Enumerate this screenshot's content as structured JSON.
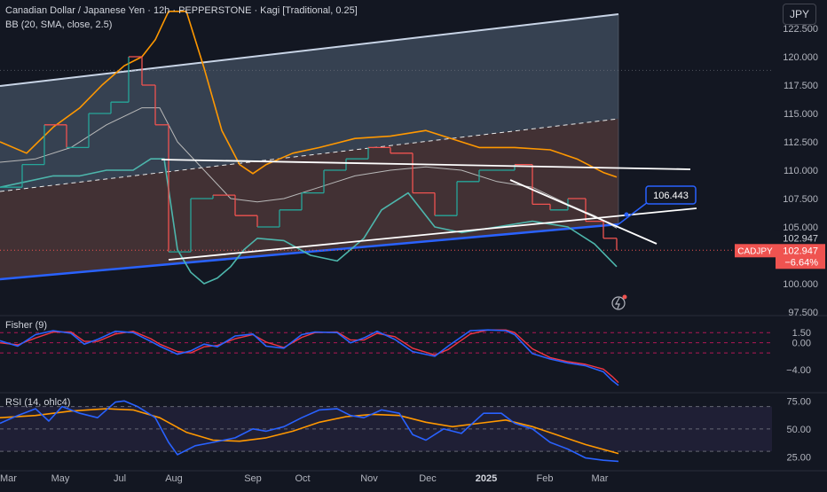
{
  "header": {
    "symbol_line": "Canadian Dollar / Japanese Yen · 12h · PEPPERSTONE · Kagi [Traditional, 0.25]",
    "indicator_line": "BB (20, SMA, close, 2.5)",
    "currency_button": "JPY"
  },
  "price_labels": {
    "last_price": "102.947",
    "symbol_tag": "CADJPY",
    "tag_price": "102.947",
    "tag_change": "−6.64%",
    "target_label": "106.443"
  },
  "colors": {
    "background": "#131722",
    "kagi_up": "#26a69a",
    "kagi_down": "#ef5350",
    "bb_upper": "#ff9800",
    "bb_basis": "#b8b8b8",
    "bb_lower": "#4db6ac",
    "channel_line": "#2962ff",
    "fisher": "#2962ff",
    "fisher_trigger": "#f23645",
    "rsi": "#2962ff",
    "rsi_ma": "#ff9800"
  },
  "chart_data": [
    {
      "type": "line",
      "title": "Canadian Dollar / Japanese Yen · 12h · PEPPERSTONE · Kagi [Traditional, 0.25]",
      "ylim": [
        97.5,
        125.0
      ],
      "y_ticks": [
        "97.500",
        "100.000",
        "102.500",
        "105.000",
        "107.500",
        "110.000",
        "112.500",
        "115.000",
        "117.500",
        "120.000",
        "122.500"
      ],
      "x_ticks": [
        "Mar",
        "May",
        "Jul",
        "Aug",
        "Sep",
        "Oct",
        "Nov",
        "Dec",
        "2025",
        "Feb",
        "Mar"
      ],
      "series": [
        {
          "role": "price-kagi",
          "x": [
            0,
            25,
            50,
            75,
            100,
            125,
            145,
            160,
            175,
            190,
            215,
            240,
            265,
            290,
            315,
            340,
            365,
            390,
            415,
            440,
            465,
            490,
            515,
            540,
            565,
            580,
            600,
            620,
            640,
            660,
            680,
            695
          ],
          "values": [
            108.5,
            110.5,
            114.0,
            112.0,
            115.0,
            116.0,
            120.0,
            117.5,
            114.0,
            102.8,
            107.5,
            107.8,
            106.0,
            105.0,
            106.5,
            108.0,
            110.0,
            111.0,
            112.0,
            111.5,
            108.0,
            106.0,
            109.0,
            110.0,
            110.0,
            110.5,
            107.0,
            106.5,
            107.5,
            105.5,
            104.0,
            102.947
          ]
        },
        {
          "name": "BB",
          "role": "bb-upper",
          "x": [
            0,
            30,
            60,
            90,
            115,
            140,
            160,
            175,
            190,
            210,
            230,
            250,
            270,
            285,
            300,
            330,
            360,
            400,
            440,
            480,
            500,
            540,
            580,
            620,
            650,
            680,
            695
          ],
          "values": [
            112.5,
            111.5,
            113.8,
            115.5,
            117.5,
            119.2,
            120.0,
            121.5,
            124.0,
            124.0,
            119.0,
            113.5,
            110.5,
            109.7,
            110.5,
            111.5,
            112.0,
            112.8,
            113.0,
            113.5,
            113.0,
            112.0,
            112.0,
            111.8,
            111.0,
            109.8,
            109.4
          ]
        },
        {
          "name": "BB",
          "role": "bb-basis",
          "x": [
            0,
            40,
            80,
            120,
            160,
            180,
            200,
            230,
            260,
            290,
            320,
            360,
            400,
            440,
            480,
            520,
            560,
            600,
            640,
            670,
            695
          ],
          "values": [
            110.7,
            111.0,
            112.0,
            114.0,
            115.5,
            115.5,
            112.5,
            110.0,
            107.5,
            107.2,
            107.5,
            108.5,
            109.5,
            110.0,
            110.3,
            110.0,
            109.0,
            108.5,
            107.0,
            106.0,
            104.9
          ]
        },
        {
          "name": "BB",
          "role": "bb-lower",
          "x": [
            0,
            30,
            60,
            90,
            120,
            150,
            170,
            185,
            200,
            215,
            230,
            245,
            260,
            275,
            290,
            320,
            350,
            380,
            410,
            430,
            460,
            490,
            520,
            560,
            600,
            640,
            670,
            695
          ],
          "values": [
            108.5,
            109.0,
            109.5,
            109.5,
            110.0,
            110.0,
            111.0,
            111.0,
            103.0,
            101.0,
            100.0,
            100.5,
            101.5,
            103.0,
            104.0,
            103.8,
            102.5,
            102.0,
            104.0,
            106.5,
            108.0,
            105.0,
            104.5,
            105.0,
            105.5,
            105.0,
            103.5,
            101.5
          ]
        }
      ]
    },
    {
      "type": "line",
      "title": "Fisher (9)",
      "ylim": [
        -7.0,
        3.5
      ],
      "y_ticks": [
        "1.50",
        "0.00",
        "−4.00"
      ],
      "reference_lines": [
        1.5,
        0.0,
        -1.5
      ],
      "series": [
        {
          "role": "fisher",
          "x": [
            0,
            20,
            40,
            60,
            80,
            95,
            110,
            130,
            150,
            170,
            180,
            200,
            215,
            230,
            245,
            265,
            285,
            300,
            320,
            340,
            355,
            380,
            395,
            410,
            425,
            445,
            465,
            490,
            505,
            530,
            550,
            570,
            580,
            600,
            620,
            640,
            660,
            680,
            690,
            697
          ],
          "values": [
            0.3,
            -0.5,
            1.2,
            1.8,
            1.4,
            -0.2,
            0.5,
            1.7,
            1.5,
            0.2,
            -0.5,
            -1.7,
            -1.2,
            -0.2,
            -0.6,
            1.0,
            1.3,
            -0.5,
            -0.8,
            1.2,
            1.6,
            1.5,
            0.0,
            0.7,
            1.7,
            0.5,
            -1.3,
            -2.0,
            -0.5,
            1.8,
            1.9,
            1.8,
            1.2,
            -1.6,
            -2.4,
            -3.0,
            -3.4,
            -4.3,
            -5.6,
            -6.3
          ]
        },
        {
          "role": "fisher-trigger",
          "x": [
            0,
            20,
            40,
            60,
            80,
            95,
            110,
            130,
            150,
            170,
            180,
            200,
            215,
            230,
            245,
            265,
            285,
            300,
            320,
            340,
            355,
            380,
            395,
            410,
            425,
            445,
            465,
            490,
            505,
            530,
            550,
            570,
            580,
            600,
            620,
            640,
            660,
            680,
            690,
            697
          ],
          "values": [
            0.0,
            -0.3,
            0.7,
            1.6,
            1.6,
            0.2,
            0.2,
            1.3,
            1.7,
            0.6,
            -0.2,
            -1.3,
            -1.5,
            -0.6,
            -0.4,
            0.6,
            1.2,
            0.1,
            -0.7,
            0.8,
            1.5,
            1.6,
            0.4,
            0.4,
            1.4,
            0.9,
            -0.8,
            -1.8,
            -1.0,
            1.3,
            1.9,
            1.9,
            1.5,
            -0.9,
            -2.2,
            -2.8,
            -3.2,
            -3.9,
            -5.0,
            -5.9
          ]
        }
      ]
    },
    {
      "type": "line",
      "title": "RSI (14, ohlc4)",
      "ylim": [
        15,
        80
      ],
      "y_ticks": [
        "75.00",
        "50.00",
        "25.00"
      ],
      "reference_lines": [
        70,
        50,
        30
      ],
      "series": [
        {
          "role": "rsi",
          "x": [
            0,
            20,
            40,
            55,
            70,
            90,
            110,
            130,
            140,
            155,
            175,
            190,
            200,
            220,
            240,
            265,
            285,
            300,
            320,
            340,
            360,
            380,
            395,
            410,
            430,
            450,
            465,
            480,
            500,
            520,
            545,
            565,
            580,
            600,
            620,
            640,
            660,
            680,
            697
          ],
          "values": [
            55,
            62,
            68,
            57,
            70,
            64,
            60,
            74,
            75,
            70,
            60,
            38,
            27,
            35,
            38,
            42,
            50,
            48,
            52,
            60,
            67,
            68,
            62,
            60,
            67,
            64,
            45,
            40,
            50,
            46,
            64,
            64,
            55,
            50,
            38,
            32,
            24,
            22,
            21
          ]
        },
        {
          "role": "rsi-ma",
          "x": [
            0,
            40,
            80,
            120,
            150,
            180,
            210,
            240,
            270,
            300,
            330,
            360,
            390,
            420,
            450,
            480,
            510,
            540,
            570,
            600,
            630,
            660,
            697
          ],
          "values": [
            60,
            62,
            66,
            68,
            67,
            60,
            47,
            40,
            39,
            42,
            48,
            56,
            61,
            63,
            62,
            56,
            52,
            55,
            58,
            52,
            44,
            36,
            28
          ]
        }
      ]
    }
  ]
}
